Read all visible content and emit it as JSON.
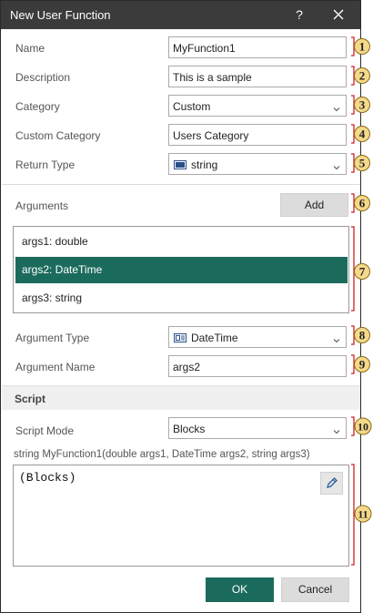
{
  "window": {
    "title": "New User Function",
    "help": "?"
  },
  "fields": {
    "name": {
      "label": "Name",
      "value": "MyFunction1"
    },
    "description": {
      "label": "Description",
      "value": "This is a sample"
    },
    "category": {
      "label": "Category",
      "value": "Custom"
    },
    "custom_category": {
      "label": "Custom Category",
      "value": "Users Category"
    },
    "return_type": {
      "label": "Return Type",
      "value": "string",
      "icon": "abc-type-icon"
    }
  },
  "arguments": {
    "label": "Arguments",
    "add_label": "Add",
    "items": [
      {
        "label": "args1: double",
        "selected": false
      },
      {
        "label": "args2: DateTime",
        "selected": true
      },
      {
        "label": "args3: string",
        "selected": false
      }
    ],
    "type": {
      "label": "Argument Type",
      "value": "DateTime",
      "icon": "calendar-type-icon"
    },
    "name": {
      "label": "Argument Name",
      "value": "args2"
    }
  },
  "script": {
    "section_title": "Script",
    "mode": {
      "label": "Script Mode",
      "value": "Blocks"
    },
    "signature": "string MyFunction1(double args1, DateTime args2, string args3)",
    "code": "(Blocks)"
  },
  "buttons": {
    "ok": "OK",
    "cancel": "Cancel"
  },
  "markers": [
    "1",
    "2",
    "3",
    "4",
    "5",
    "6",
    "7",
    "8",
    "9",
    "10",
    "11"
  ],
  "colors": {
    "accent": "#1b6b5c",
    "titlebar": "#3b3b3b",
    "marker_fill": "#f5d98a",
    "marker_bracket": "#cc2222"
  }
}
